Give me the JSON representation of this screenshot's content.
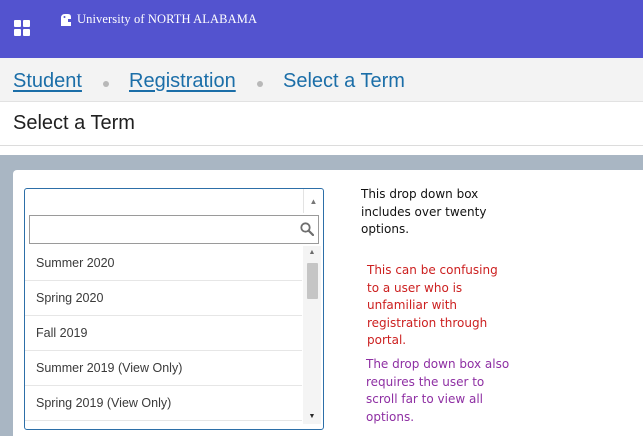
{
  "header": {
    "brand_text": "University of NORTH ALABAMA",
    "bar_color": "#5353cf"
  },
  "breadcrumb": {
    "items": [
      "Student",
      "Registration",
      "Select a Term"
    ]
  },
  "page": {
    "title": "Select a Term"
  },
  "term_select": {
    "selected_value": "",
    "search_value": "",
    "options": [
      "Summer 2020",
      "Spring 2020",
      "Fall 2019",
      "Summer 2019 (View Only)",
      "Spring 2019 (View Only)"
    ]
  },
  "annotations": {
    "note_1": "This drop down box includes over twenty options.",
    "note_2": "This can be confusing to a user who is unfamiliar with registration through portal.",
    "note_3": "The drop down box also requires the user to scroll far to view all options.",
    "colors": {
      "note_1": "#111111",
      "note_2": "#cc1f1f",
      "note_3": "#8e2fa3"
    }
  }
}
